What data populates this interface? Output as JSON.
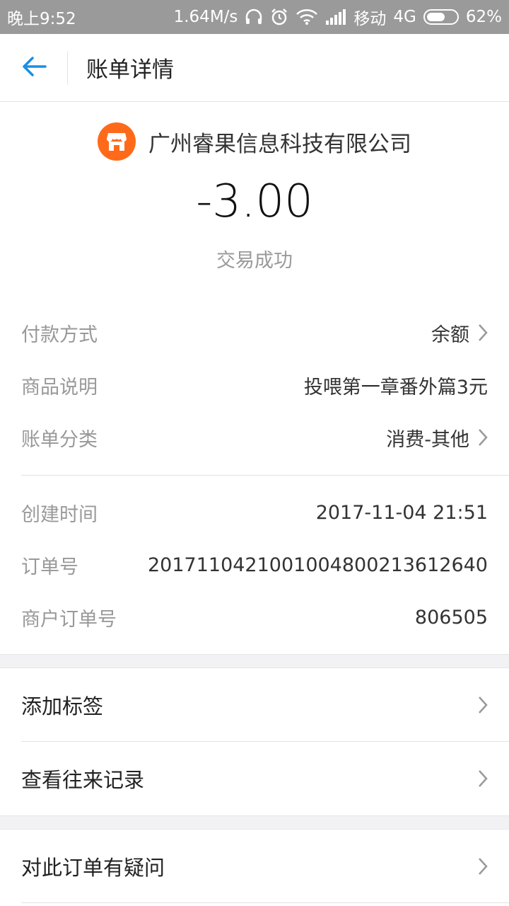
{
  "status_bar": {
    "time": "晚上9:52",
    "speed": "1.64M/s",
    "carrier": "移动",
    "network": "4G",
    "battery": "62%",
    "battery_level": 0.62,
    "icons": [
      "headphones-icon",
      "alarm-icon",
      "wifi-icon",
      "signal-icon",
      "battery-icon"
    ]
  },
  "nav": {
    "title": "账单详情"
  },
  "merchant": {
    "name": "广州睿果信息科技有限公司",
    "logo_color": "#ff6a1a"
  },
  "amount": "-3.00",
  "transaction_status": "交易成功",
  "details_group1": [
    {
      "label": "付款方式",
      "value": "余额",
      "chevron": true
    },
    {
      "label": "商品说明",
      "value": "投喂第一章番外篇3元",
      "chevron": false
    },
    {
      "label": "账单分类",
      "value": "消费-其他",
      "chevron": true
    }
  ],
  "details_group2": [
    {
      "label": "创建时间",
      "value": "2017-11-04 21:51"
    },
    {
      "label": "订单号",
      "value": "20171104210010048002136126​40"
    },
    {
      "label": "商户订单号",
      "value": "806505"
    }
  ],
  "actions": [
    {
      "label": "添加标签"
    },
    {
      "label": "查看往来记录"
    },
    {
      "label": "对此订单有疑问"
    }
  ],
  "colors": {
    "accent": "#1a8fe3",
    "merchant_orange": "#ff6a1a",
    "status_bar_bg": "#9a9a9a"
  }
}
